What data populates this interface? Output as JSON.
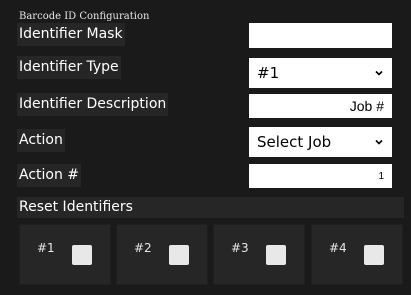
{
  "section_title": "Barcode ID Configuration",
  "rows": {
    "identifier_mask": {
      "label": "Identifier Mask",
      "value": ""
    },
    "identifier_type": {
      "label": "Identifier Type",
      "value": "#1",
      "chevron_icon": "chevron-down-icon"
    },
    "identifier_description": {
      "label": "Identifier Description",
      "value": "Job #"
    },
    "action": {
      "label": "Action",
      "value": "Select Job",
      "chevron_icon": "chevron-down-icon"
    },
    "action_number": {
      "label": "Action #",
      "value": "1"
    }
  },
  "reset": {
    "label": "Reset Identifiers",
    "items": [
      {
        "label": "#1"
      },
      {
        "label": "#2"
      },
      {
        "label": "#3"
      },
      {
        "label": "#4"
      }
    ]
  },
  "colors": {
    "background": "#1a1a1a",
    "label_background": "#262626",
    "field_background": "#ffffff",
    "checkbox": "#e8e8e8"
  }
}
